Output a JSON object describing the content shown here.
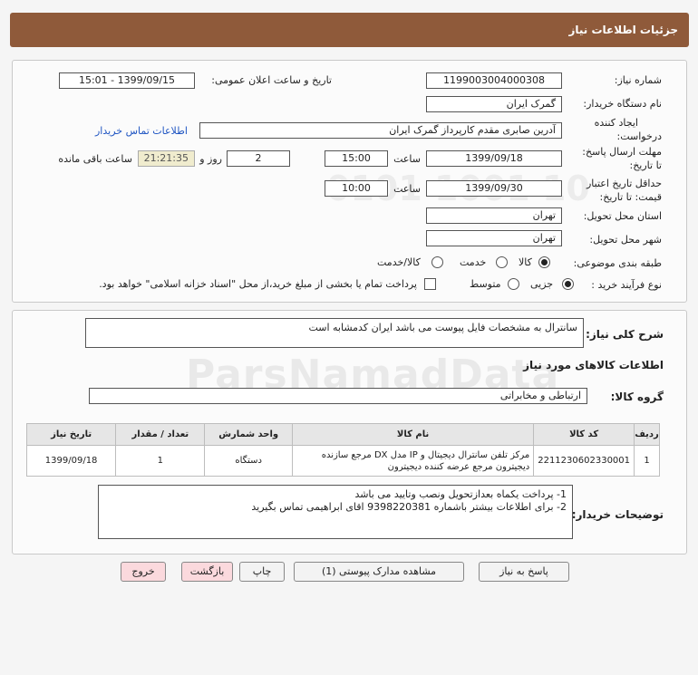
{
  "header": {
    "title": "جزئیات اطلاعات نیاز"
  },
  "watermark": {
    "main": "ParsNamadData",
    "digits": "0101 1001 10"
  },
  "form": {
    "need_number_label": "شماره نیاز:",
    "need_number": "1199003004000308",
    "announce_label": "تاریخ و ساعت اعلان عمومی:",
    "announce_value": "1399/09/15 - 15:01",
    "buyer_org_label": "نام دستگاه خریدار:",
    "buyer_org": "گمرک ایران",
    "creator_label_1": "ایجاد کننده",
    "creator_label_2": "درخواست:",
    "creator": "آدرین صابری مقدم کارپرداز گمرک ایران",
    "contact_link": "اطلاعات تماس خریدار",
    "deadline_label_1": "مهلت ارسال پاسخ:",
    "deadline_label_2": "تا تاریخ:",
    "deadline_date": "1399/09/18",
    "time_label": "ساعت",
    "deadline_time": "15:00",
    "days_value": "2",
    "days_label": "روز و",
    "remaining_time": "21:21:35",
    "remaining_label": "ساعت باقی مانده",
    "validity_label_1": "حداقل تاریخ اعتبار",
    "validity_label_2": "قیمت: تا تاریخ:",
    "validity_date": "1399/09/30",
    "validity_time_label": "ساعت",
    "validity_time": "10:00",
    "province_label": "استان محل تحویل:",
    "province": "تهران",
    "city_label": "شهر محل تحویل:",
    "city": "تهران",
    "category_label": "طبقه بندی موضوعی:",
    "category_options": [
      "کالا",
      "خدمت",
      "کالا/خدمت"
    ],
    "process_label": "نوع فرآیند خرید :",
    "process_options": [
      "جزیی",
      "متوسط"
    ],
    "payment_note": "پرداخت تمام یا بخشی از مبلغ خرید،از محل \"اسناد خزانه اسلامی\" خواهد بود."
  },
  "details": {
    "summary_label": "شرح کلی نیاز:",
    "summary": "سانترال به مشخصات فایل پیوست می باشد ایران کدمشابه است",
    "goods_info_title": "اطلاعات کالاهای مورد نیاز",
    "group_label": "گروه کالا:",
    "group_value": "ارتباطی و مخابراتی",
    "table": {
      "headers": [
        "ردیف",
        "کد کالا",
        "نام کالا",
        "واحد شمارش",
        "تعداد / مقدار",
        "تاریخ نیاز"
      ],
      "rows": [
        {
          "row": "1",
          "code": "2211230602330001",
          "name": "مرکز تلفن سانترال دیجیتال و IP مدل DX مرجع سازنده دیجیترون مرجع عرضه کننده دیجیترون",
          "unit": "دستگاه",
          "qty": "1",
          "date": "1399/09/18"
        }
      ]
    },
    "buyer_notes_label": "توضیحات خریدار:",
    "buyer_notes_1": "1- پرداخت یکماه  بعدازتحویل ونصب وتایید می باشد",
    "buyer_notes_2": "2- برای اطلاعات بیشتر باشماره 9398220381 اقای ابراهیمی تماس بگیرید"
  },
  "buttons": {
    "reply": "پاسخ به نیاز",
    "attachments": "مشاهده مدارک پیوستی (1)",
    "print": "چاپ",
    "back": "بازگشت",
    "exit": "خروج"
  }
}
